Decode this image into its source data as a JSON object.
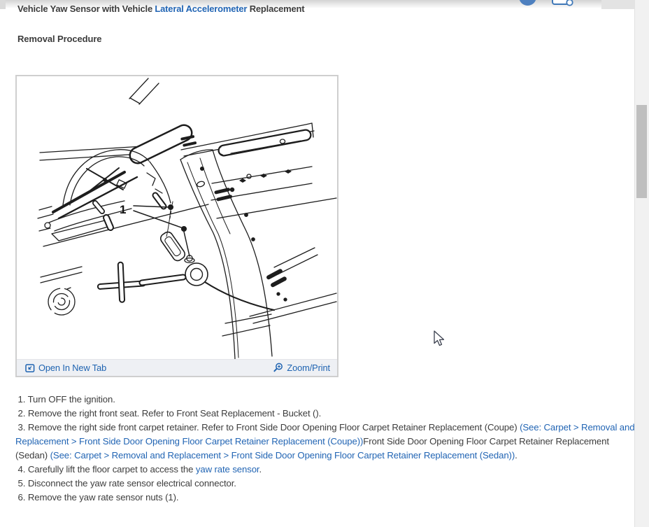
{
  "header": {
    "title_pre": "Vehicle Yaw Sensor with Vehicle ",
    "title_link": "Lateral Accelerometer",
    "title_post": " Replacement",
    "section_heading": "Removal Procedure"
  },
  "figure": {
    "open_in_new_tab": "Open In New Tab",
    "zoom_print": "Zoom/Print",
    "callout": "1"
  },
  "steps": [
    [
      {
        "t": " 1. Turn OFF the ignition.",
        "link": false
      }
    ],
    [
      {
        "t": " 2. Remove the right front seat. Refer to Front Seat Replacement - Bucket ().",
        "link": false
      }
    ],
    [
      {
        "t": " 3. Remove the right side front carpet retainer. Refer to Front Side Door Opening Floor Carpet Retainer Replacement (Coupe) ",
        "link": false
      },
      {
        "t": "(See: Carpet > Removal and Replacement > Front Side Door Opening Floor Carpet Retainer Replacement (Coupe))",
        "link": true
      },
      {
        "t": "Front Side Door Opening Floor Carpet Retainer Replacement (Sedan) ",
        "link": false
      },
      {
        "t": "(See: Carpet > Removal and Replacement > Front Side Door Opening Floor Carpet Retainer Replacement (Sedan))",
        "link": true
      },
      {
        "t": ".",
        "link": false
      }
    ],
    [
      {
        "t": " 4. Carefully lift the floor carpet to access the ",
        "link": false
      },
      {
        "t": "yaw rate sensor",
        "link": true
      },
      {
        "t": ".",
        "link": false
      }
    ],
    [
      {
        "t": " 5. Disconnect the yaw rate sensor electrical connector.",
        "link": false
      }
    ],
    [
      {
        "t": " 6. Remove the yaw rate sensor nuts (1).",
        "link": false
      }
    ]
  ],
  "colors": {
    "link_blue": "#2265b4",
    "figure_link_blue": "#1e63b1",
    "icon_blue": "#4e80bf",
    "figure_bar_bg": "#eef0f4",
    "frame_border": "#cfcfcf"
  }
}
